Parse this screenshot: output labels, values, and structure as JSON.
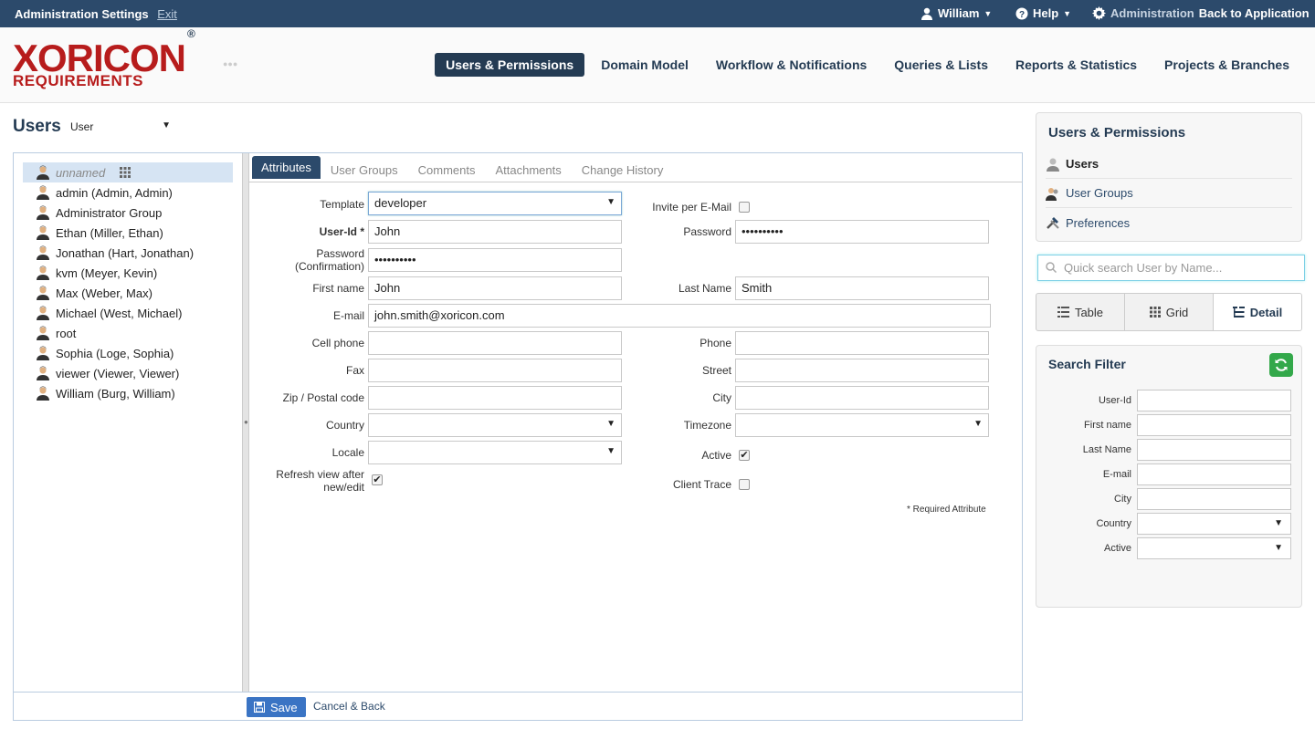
{
  "topbar": {
    "title": "Administration Settings",
    "exit": "Exit",
    "user": "William",
    "help": "Help",
    "admin_label": "Administration",
    "back_label": "Back to Application"
  },
  "logo": {
    "main": "XORICON",
    "sub": "REQUIREMENTS",
    "registered": "®"
  },
  "nav": [
    {
      "label": "Users & Permissions"
    },
    {
      "label": "Domain Model"
    },
    {
      "label": "Workflow & Notifications"
    },
    {
      "label": "Queries & Lists"
    },
    {
      "label": "Reports & Statistics"
    },
    {
      "label": "Projects & Branches"
    }
  ],
  "page": {
    "title": "Users",
    "type_select": "User"
  },
  "users": [
    {
      "label": "unnamed"
    },
    {
      "label": "admin (Admin, Admin)"
    },
    {
      "label": "Administrator Group"
    },
    {
      "label": "Ethan (Miller, Ethan)"
    },
    {
      "label": "Jonathan (Hart, Jonathan)"
    },
    {
      "label": "kvm (Meyer, Kevin)"
    },
    {
      "label": "Max (Weber, Max)"
    },
    {
      "label": "Michael (West, Michael)"
    },
    {
      "label": "root"
    },
    {
      "label": "Sophia (Loge, Sophia)"
    },
    {
      "label": "viewer (Viewer, Viewer)"
    },
    {
      "label": "William (Burg, William)"
    }
  ],
  "tabs": [
    {
      "label": "Attributes"
    },
    {
      "label": "User Groups"
    },
    {
      "label": "Comments"
    },
    {
      "label": "Attachments"
    },
    {
      "label": "Change History"
    }
  ],
  "form": {
    "template_label": "Template",
    "template_value": "developer",
    "invite_label": "Invite per E-Mail",
    "userid_label": "User-Id *",
    "userid_value": "John",
    "password_label": "Password",
    "password_value": "••••••••••",
    "password_confirm_label_1": "Password",
    "password_confirm_label_2": "(Confirmation)",
    "password_confirm_value": "••••••••••",
    "firstname_label": "First name",
    "firstname_value": "John",
    "lastname_label": "Last Name",
    "lastname_value": "Smith",
    "email_label": "E-mail",
    "email_value": "john.smith@xoricon.com",
    "cellphone_label": "Cell phone",
    "phone_label": "Phone",
    "fax_label": "Fax",
    "street_label": "Street",
    "zip_label": "Zip / Postal code",
    "city_label": "City",
    "country_label": "Country",
    "timezone_label": "Timezone",
    "locale_label": "Locale",
    "active_label": "Active",
    "refresh_label_1": "Refresh view after",
    "refresh_label_2": "new/edit",
    "clienttrace_label": "Client Trace",
    "required_note": "* Required Attribute",
    "checkbox_mark": "✔"
  },
  "footer": {
    "save": "Save",
    "cancel": "Cancel & Back"
  },
  "sidepanel": {
    "title": "Users & Permissions",
    "items": [
      {
        "label": "Users"
      },
      {
        "label": "User Groups"
      },
      {
        "label": "Preferences"
      }
    ]
  },
  "search": {
    "placeholder": "Quick search User by Name..."
  },
  "views": [
    {
      "label": "Table"
    },
    {
      "label": "Grid"
    },
    {
      "label": "Detail"
    }
  ],
  "filter": {
    "title": "Search Filter",
    "fields": [
      {
        "label": "User-Id"
      },
      {
        "label": "First name"
      },
      {
        "label": "Last Name"
      },
      {
        "label": "E-mail"
      },
      {
        "label": "City"
      },
      {
        "label": "Country"
      },
      {
        "label": "Active"
      }
    ]
  },
  "colors": {
    "navy": "#243b53",
    "topbar": "#2c4a6b",
    "logo_red": "#b71c1c",
    "selection": "#d6e4f3",
    "save_blue": "#3a74c4",
    "refresh_green": "#33a84a"
  },
  "icons": [
    "user-icon",
    "help-icon",
    "gear-icon",
    "grid-icon",
    "search-icon",
    "table-icon",
    "detail-icon",
    "refresh-icon",
    "save-icon",
    "user-group-icon",
    "preferences-icon"
  ]
}
